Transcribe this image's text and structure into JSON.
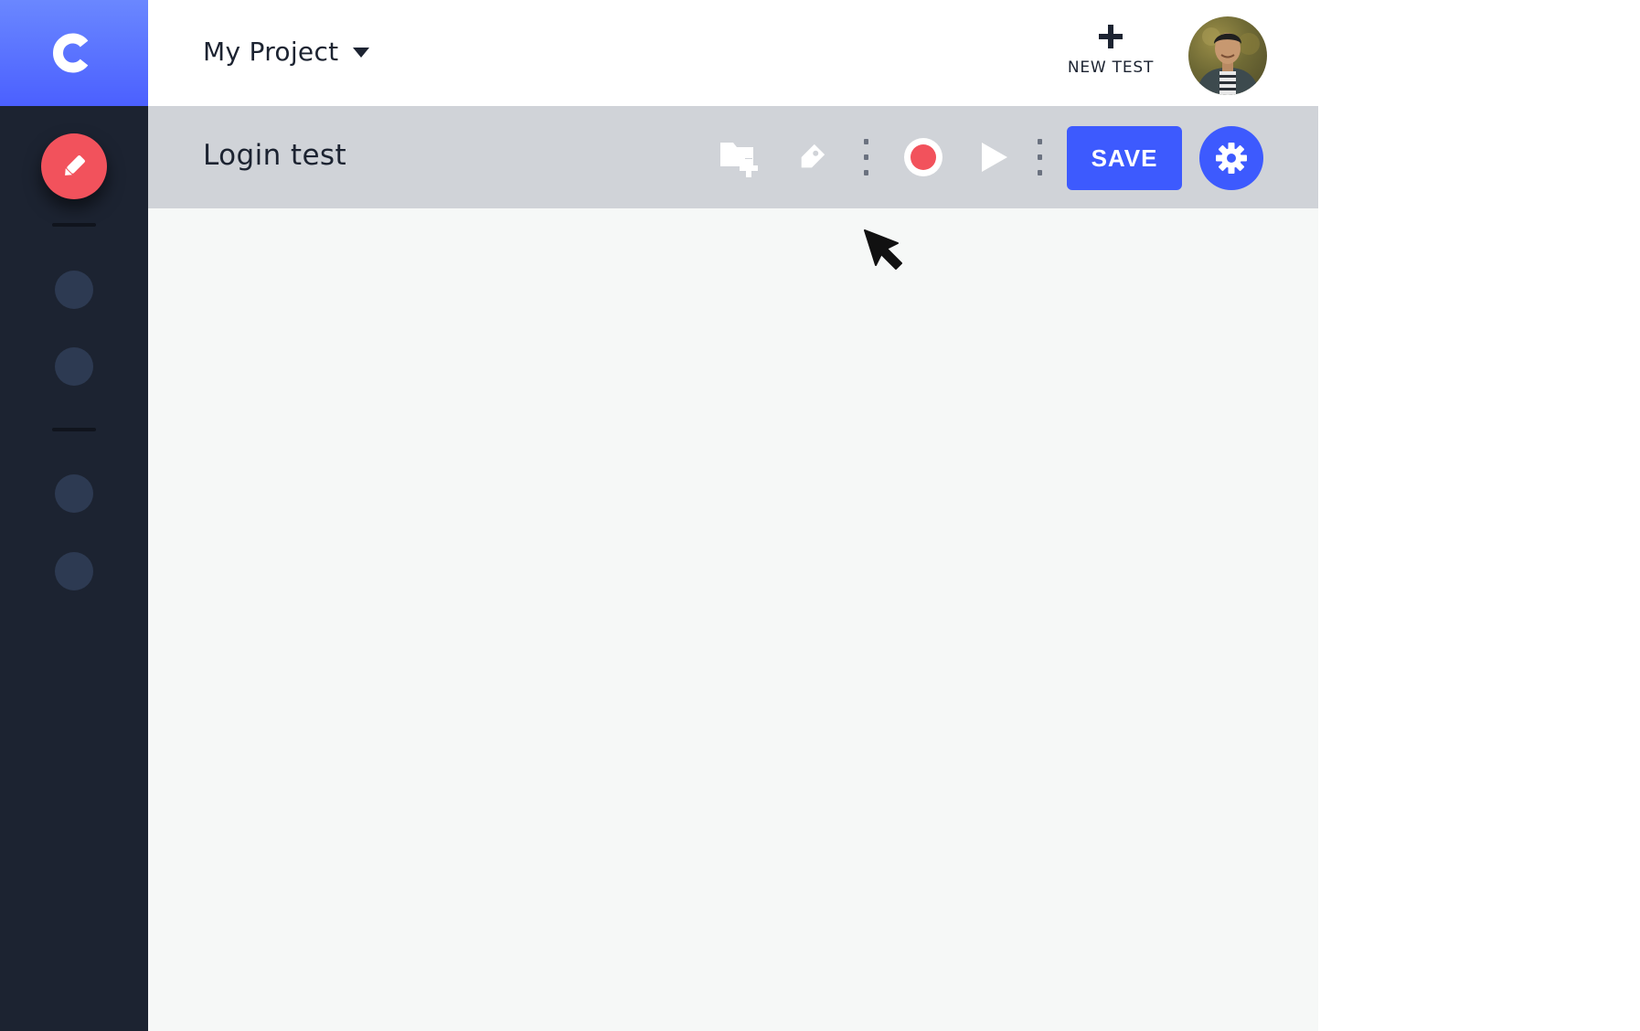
{
  "app": {
    "logo_letter": "C"
  },
  "header": {
    "project_name": "My Project",
    "new_test_label": "NEW TEST"
  },
  "toolbar": {
    "test_title": "Login test",
    "save_label": "SAVE"
  },
  "colors": {
    "brand_blue": "#4b60ff",
    "sidebar_bg": "#1c2331",
    "record_red": "#f2525c",
    "toolbar_bg": "#d0d3d8",
    "canvas_bg": "#f6f8f7"
  },
  "icons": {
    "brand": "c-logo-icon",
    "fab": "pencil-icon",
    "new_test": "plus-icon",
    "folder": "folder-add-icon",
    "tag": "tag-icon",
    "record": "record-icon",
    "play": "play-icon",
    "settings": "gear-icon",
    "cursor": "mouse-cursor-icon"
  }
}
